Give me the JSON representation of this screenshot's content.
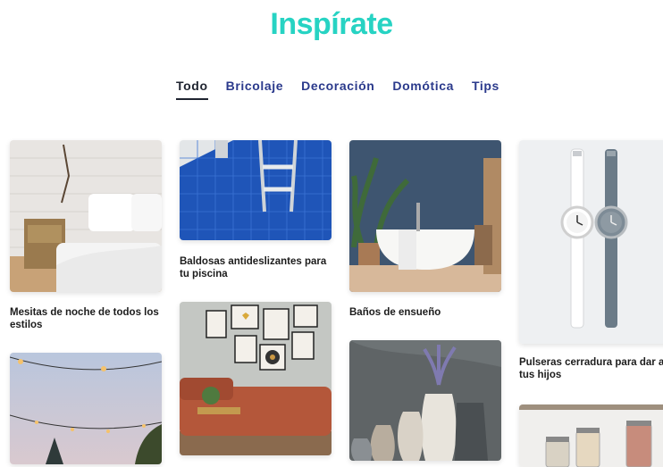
{
  "page": {
    "title": "Inspírate"
  },
  "tabs": [
    {
      "label": "Todo",
      "active": true
    },
    {
      "label": "Bricolaje",
      "active": false
    },
    {
      "label": "Decoración",
      "active": false
    },
    {
      "label": "Domótica",
      "active": false
    },
    {
      "label": "Tips",
      "active": false
    }
  ],
  "articles": [
    {
      "caption": "Mesitas de noche de todos los estilos",
      "image": "bedroom-nightstand-image"
    },
    {
      "caption": "Baldosas antideslizantes para tu piscina",
      "image": "pool-ladder-image"
    },
    {
      "caption": "Baños de ensueño",
      "image": "bathroom-bathtub-image"
    },
    {
      "caption": "Pulseras cerradura para dar a tus hijos",
      "image": "watches-image"
    },
    {
      "caption": "",
      "image": "garden-lights-image"
    },
    {
      "caption": "",
      "image": "living-room-image"
    },
    {
      "caption": "",
      "image": "vases-image"
    },
    {
      "caption": "",
      "image": "kitchen-jars-image"
    }
  ],
  "colors": {
    "accent": "#27d3c3",
    "tab": "#2b3a8c",
    "tab_active": "#1f2430"
  }
}
